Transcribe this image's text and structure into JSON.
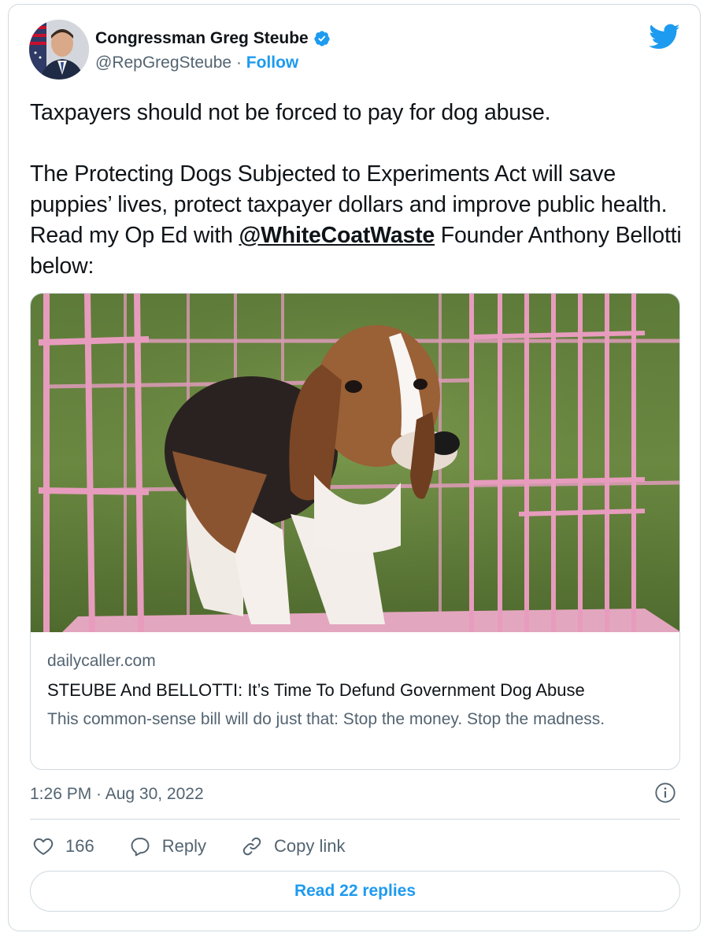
{
  "author": {
    "name": "Congressman Greg Steube",
    "handle": "@RepGregSteube",
    "separator": "·",
    "follow_label": "Follow"
  },
  "tweet": {
    "line1": "Taxpayers should not be forced to pay for dog abuse.",
    "para2_before_mention": "The Protecting Dogs Subjected to Experiments Act will save puppies’ lives, protect taxpayer dollars and improve public health. Read my Op Ed with",
    "mention": "@WhiteCoatWaste",
    "para2_after_mention": "Founder Anthony Bellotti below:"
  },
  "link_card": {
    "domain": "dailycaller.com",
    "title": "STEUBE And BELLOTTI: It’s Time To Defund Government Dog Abuse",
    "description": "This common-sense bill will do just that: Stop the money. Stop the madness."
  },
  "timestamp": "1:26 PM · Aug 30, 2022",
  "actions": {
    "likes_count": "166",
    "reply_label": "Reply",
    "copy_link_label": "Copy link"
  },
  "read_replies_label": "Read 22 replies",
  "colors": {
    "accent": "#1d9bf0",
    "secondary_text": "#536471",
    "border": "#cfd9de",
    "text": "#0f1419"
  },
  "icons": [
    "verified-badge-icon",
    "twitter-bird-icon",
    "info-icon",
    "heart-icon",
    "reply-bubble-icon",
    "link-icon"
  ]
}
